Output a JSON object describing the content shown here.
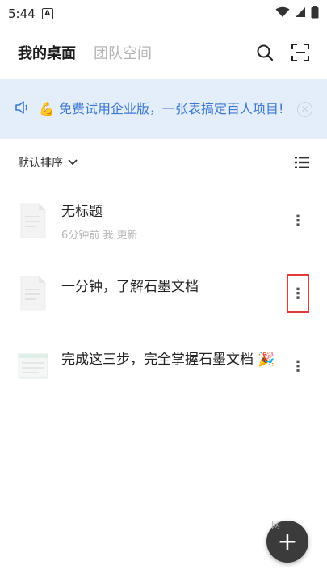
{
  "status_bar": {
    "time": "5:44",
    "notification_letter": "A"
  },
  "header": {
    "tabs": [
      {
        "label": "我的桌面"
      },
      {
        "label": "团队空间"
      }
    ]
  },
  "banner": {
    "emoji": "💪",
    "text": "免费试用企业版，一张表搞定百人项目!"
  },
  "sort": {
    "label": "默认排序"
  },
  "documents": [
    {
      "title": "无标题",
      "meta": "6分钟前 我 更新"
    },
    {
      "title": "一分钟，了解石墨文档",
      "meta": ""
    },
    {
      "title": "完成这三步，完全掌握石墨文档 🎉",
      "meta": ""
    }
  ],
  "fab": {
    "label": "+",
    "watermark": "网"
  },
  "colors": {
    "banner_bg": "#e4eefb",
    "banner_text": "#3c78d0",
    "highlight": "#e53a3a",
    "fab": "#3b3b3b"
  }
}
